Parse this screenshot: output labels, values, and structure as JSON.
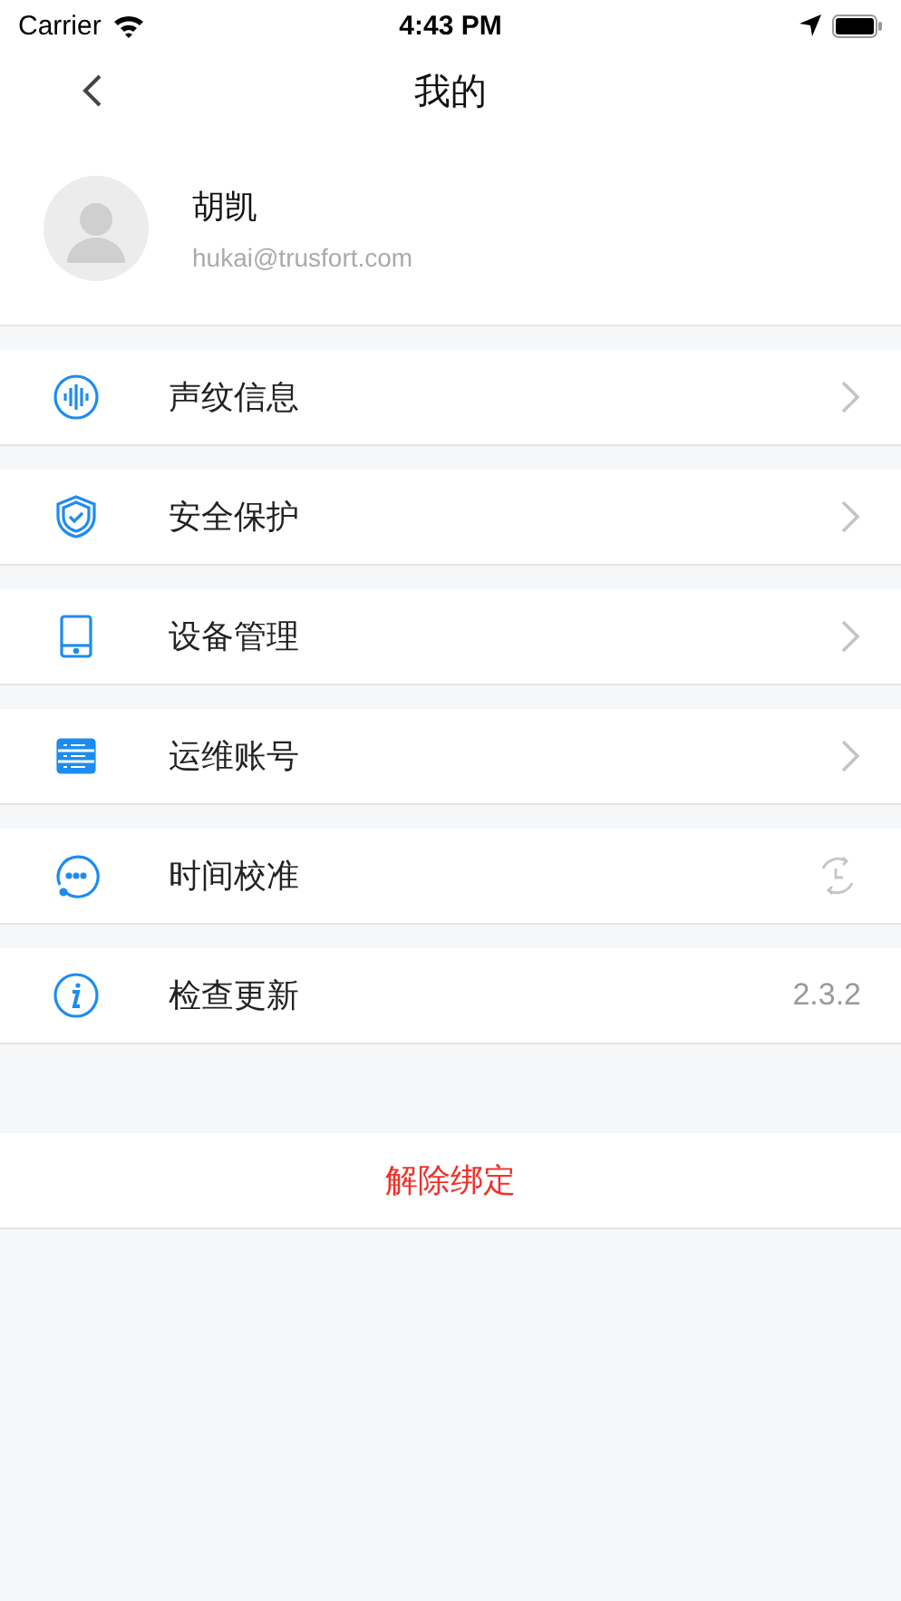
{
  "status_bar": {
    "carrier": "Carrier",
    "time": "4:43 PM"
  },
  "nav": {
    "title": "我的"
  },
  "profile": {
    "name": "胡凯",
    "email": "hukai@trusfort.com"
  },
  "menu": [
    {
      "label": "声纹信息",
      "kind": "link"
    },
    {
      "label": "安全保护",
      "kind": "link"
    },
    {
      "label": "设备管理",
      "kind": "link"
    },
    {
      "label": "运维账号",
      "kind": "link"
    },
    {
      "label": "时间校准",
      "kind": "sync"
    },
    {
      "label": "检查更新",
      "kind": "value",
      "value": "2.3.2"
    }
  ],
  "unbind_button": "解除绑定"
}
